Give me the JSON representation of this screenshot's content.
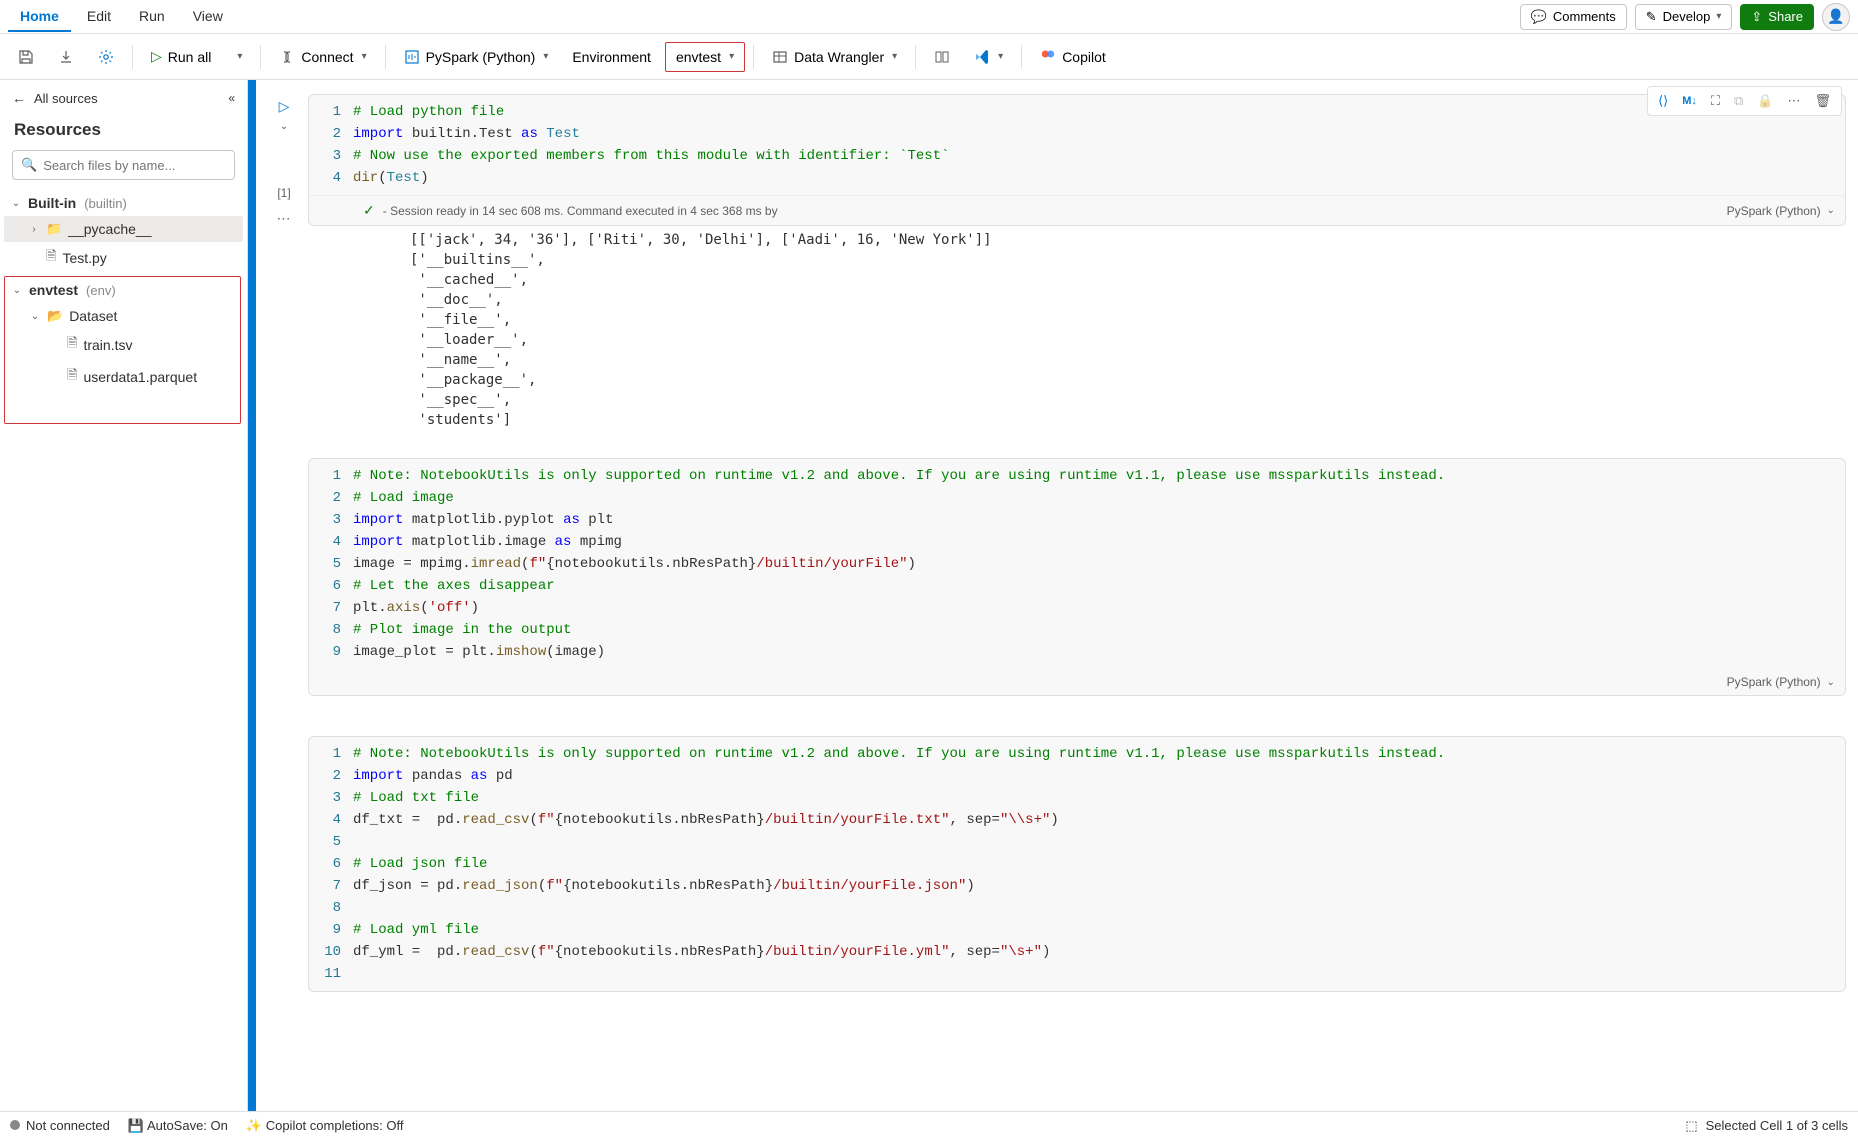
{
  "menubar": {
    "tabs": [
      "Home",
      "Edit",
      "Run",
      "View"
    ],
    "comments": "Comments",
    "develop": "Develop",
    "share": "Share"
  },
  "toolbar": {
    "run_all": "Run all",
    "connect": "Connect",
    "pyspark": "PySpark (Python)",
    "environment": "Environment",
    "envtest": "envtest",
    "data_wrangler": "Data Wrangler",
    "copilot": "Copilot"
  },
  "sidebar": {
    "back_label": "All sources",
    "title": "Resources",
    "search_placeholder": "Search files by name...",
    "builtin": {
      "label": "Built-in",
      "suffix": "(builtin)"
    },
    "pycache": "__pycache__",
    "testpy": "Test.py",
    "envtest": {
      "label": "envtest",
      "suffix": "(env)"
    },
    "dataset": "Dataset",
    "train": "train.tsv",
    "userdata": "userdata1.parquet"
  },
  "nb_toolbar": {
    "md": "M↓"
  },
  "cell1": {
    "idx": "[1]",
    "ln": [
      "1",
      "2",
      "3",
      "4"
    ],
    "code_html": "<span class=\"c-comment\"># Load python file</span>\n<span class=\"c-keyword\">import</span> builtin.Test <span class=\"c-keyword\">as</span> <span class=\"c-builtin\">Test</span>\n<span class=\"c-comment\"># Now use the exported members from this module with identifier: `Test`</span>\n<span class=\"c-func\">dir</span>(<span class=\"c-builtin\">Test</span>)",
    "status_text": " - Session ready in 14 sec 608 ms. Command executed in 4 sec 368 ms by",
    "lang": "PySpark (Python)",
    "output": "[['jack', 34, '36'], ['Riti', 30, 'Delhi'], ['Aadi', 16, 'New York']]\n['__builtins__',\n '__cached__',\n '__doc__',\n '__file__',\n '__loader__',\n '__name__',\n '__package__',\n '__spec__',\n 'students']"
  },
  "cell2": {
    "ln": [
      "1",
      "2",
      "3",
      "4",
      "5",
      "6",
      "7",
      "8",
      "9"
    ],
    "code_html": "<span class=\"c-comment\"># Note: NotebookUtils is only supported on runtime v1.2 and above. If you are using runtime v1.1, please use mssparkutils instead.</span>\n<span class=\"c-comment\"># Load image</span>\n<span class=\"c-keyword\">import</span> matplotlib.pyplot <span class=\"c-keyword\">as</span> plt\n<span class=\"c-keyword\">import</span> matplotlib.image <span class=\"c-keyword\">as</span> mpimg\nimage = mpimg.<span class=\"c-func\">imread</span>(<span class=\"c-string\">f&quot;</span>{notebookutils.nbResPath}<span class=\"c-string\">/builtin/yourFile&quot;</span>)\n<span class=\"c-comment\"># Let the axes disappear</span>\nplt.<span class=\"c-func\">axis</span>(<span class=\"c-string\">'off'</span>)\n<span class=\"c-comment\"># Plot image in the output</span>\nimage_plot = plt.<span class=\"c-func\">imshow</span>(image)",
    "lang": "PySpark (Python)"
  },
  "cell3": {
    "ln": [
      "1",
      "2",
      "3",
      "4",
      "5",
      "6",
      "7",
      "8",
      "9",
      "10",
      "11"
    ],
    "code_html": "<span class=\"c-comment\"># Note: NotebookUtils is only supported on runtime v1.2 and above. If you are using runtime v1.1, please use mssparkutils instead.</span>\n<span class=\"c-keyword\">import</span> pandas <span class=\"c-keyword\">as</span> pd\n<span class=\"c-comment\"># Load txt file</span>\ndf_txt =  pd.<span class=\"c-func\">read_csv</span>(<span class=\"c-string\">f&quot;</span>{notebookutils.nbResPath}<span class=\"c-string\">/builtin/yourFile.txt&quot;</span>, sep=<span class=\"c-string\">&quot;\\\\s+&quot;</span>)\n\n<span class=\"c-comment\"># Load json file</span>\ndf_json = pd.<span class=\"c-func\">read_json</span>(<span class=\"c-string\">f&quot;</span>{notebookutils.nbResPath}<span class=\"c-string\">/builtin/yourFile.json&quot;</span>)\n\n<span class=\"c-comment\"># Load yml file</span>\ndf_yml =  pd.<span class=\"c-func\">read_csv</span>(<span class=\"c-string\">f&quot;</span>{notebookutils.nbResPath}<span class=\"c-string\">/builtin/yourFile.yml&quot;</span>, sep=<span class=\"c-string\">&quot;\\s+&quot;</span>)\n"
  },
  "statusbar": {
    "connected": "Not connected",
    "autosave": "AutoSave: On",
    "copilot": "Copilot completions: Off",
    "selection": "Selected Cell 1 of 3 cells"
  }
}
